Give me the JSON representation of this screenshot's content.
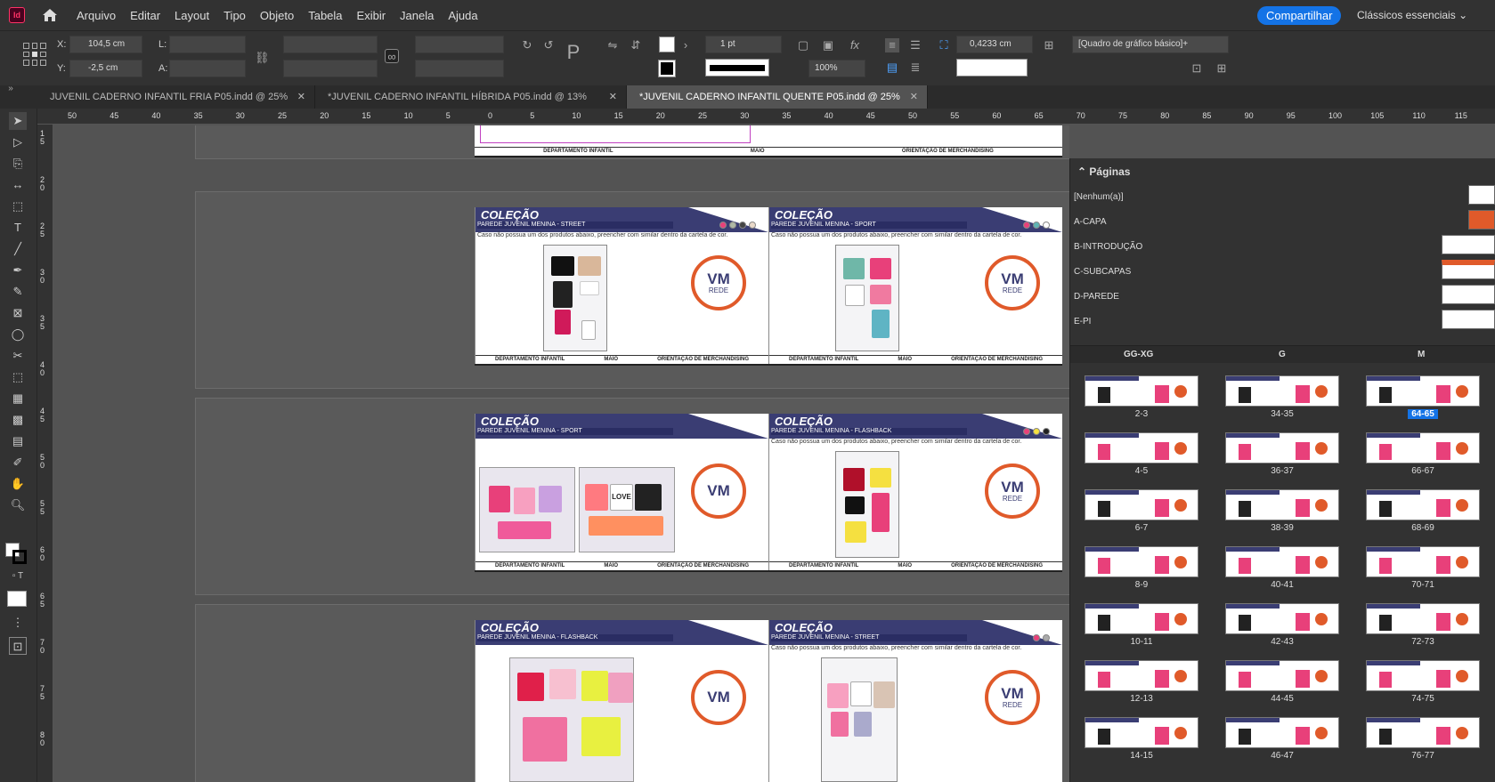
{
  "app": {
    "logo": "Id",
    "menu": [
      "Arquivo",
      "Editar",
      "Layout",
      "Tipo",
      "Objeto",
      "Tabela",
      "Exibir",
      "Janela",
      "Ajuda"
    ],
    "share": "Compartilhar",
    "workspace": "Clássicos essenciais"
  },
  "control": {
    "x_label": "X:",
    "x_value": "104,5 cm",
    "y_label": "Y:",
    "y_value": "-2,5 cm",
    "l_label": "L:",
    "a_label": "A:",
    "stroke_weight": "1 pt",
    "scale": "100%",
    "spacing": "0,4233 cm",
    "object_style": "[Quadro de gráfico básico]+"
  },
  "tabs": [
    {
      "label": "JUVENIL CADERNO INFANTIL FRIA P05.indd @ 25%"
    },
    {
      "label": "*JUVENIL CADERNO INFANTIL HÍBRIDA P05.indd @ 13%"
    },
    {
      "label": "*JUVENIL CADERNO INFANTIL QUENTE P05.indd @ 25%",
      "active": true
    }
  ],
  "hruler_labels": [
    "50",
    "45",
    "40",
    "35",
    "30",
    "25",
    "20",
    "15",
    "10",
    "5",
    "0",
    "5",
    "10",
    "15",
    "20",
    "25",
    "30",
    "35",
    "40",
    "45",
    "50",
    "55",
    "60",
    "65",
    "70",
    "75",
    "80",
    "85",
    "90",
    "95",
    "100",
    "105",
    "110",
    "115"
  ],
  "vruler_labels": [
    "1 5",
    "2 0",
    "2 5",
    "3 0",
    "3 5",
    "4 0",
    "4 5",
    "5 0",
    "5 5",
    "6 0",
    "6 5",
    "7 0",
    "7 5",
    "8 0"
  ],
  "canvas": {
    "collection": "COLEÇÃO",
    "subtitles": [
      "PAREDE JUVENIL MENINA - STREET",
      "PAREDE JUVENIL MENINA - SPORT",
      "PAREDE JUVENIL MENINA - SPORT",
      "PAREDE JUVENIL MENINA - FLASHBACK",
      "PAREDE JUVENIL MENINA - FLASHBACK",
      "PAREDE JUVENIL MENINA - STREET"
    ],
    "note": "Caso não possua um dos produtos abaixo, preencher com similar dentro da cartela de cor.",
    "badge_vm": "VM",
    "badge_rede": "REDE",
    "footer_dept": "DEPARTAMENTO INFANTIL",
    "footer_month": "MAIO",
    "footer_orient": "ORIENTAÇÃO DE MERCHANDISING",
    "love_text": "LOVE"
  },
  "pages_panel": {
    "title": "Páginas",
    "masters": [
      "[Nenhum(a)]",
      "A-CAPA",
      "B-INTRODUÇÃO",
      "C-SUBCAPAS",
      "D-PAREDE",
      "E-PI"
    ],
    "columns": [
      "GG-XG",
      "G",
      "M"
    ],
    "col1": [
      "2-3",
      "4-5",
      "6-7",
      "8-9",
      "10-11",
      "12-13",
      "14-15"
    ],
    "col2": [
      "34-35",
      "36-37",
      "38-39",
      "40-41",
      "42-43",
      "44-45",
      "46-47"
    ],
    "col3": [
      "64-65",
      "66-67",
      "68-69",
      "70-71",
      "72-73",
      "74-75",
      "76-77"
    ],
    "selected": "64-65"
  },
  "colors": {
    "accent": "#1473e6",
    "header_navy": "#3a3d73",
    "badge_orange": "#e05a2a",
    "pink": "#e8407a"
  }
}
